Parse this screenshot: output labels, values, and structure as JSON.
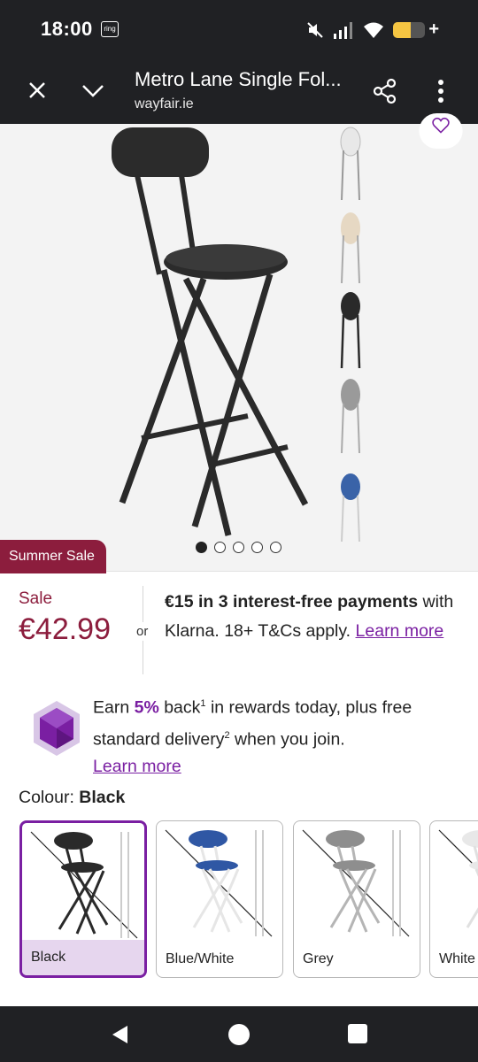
{
  "status_bar": {
    "time": "18:00",
    "ring_label": "ring",
    "battery_level": 0.55
  },
  "header": {
    "title": "Metro Lane Single Fol...",
    "url": "wayfair.ie"
  },
  "gallery": {
    "sale_tag": "Summer Sale",
    "pages": 5,
    "active_page": 1,
    "thumbnail_colors": [
      "#e8e8e8",
      "#e6d8c3",
      "#2a2a2a",
      "#9a9a9a",
      "#3a63a8"
    ]
  },
  "price": {
    "sale_label": "Sale",
    "value": "€42.99",
    "or_text": "or"
  },
  "klarna": {
    "headline": "€15 in 3 interest-free payments",
    "rest": " with Klarna. 18+ T&Cs apply. ",
    "learn_more": "Learn more"
  },
  "rewards": {
    "earn": "Earn ",
    "percent": "5%",
    "back": " back",
    "sup1": "1",
    "mid": " in rewards today, plus free standard delivery",
    "sup2": "2",
    "end": " when you join.",
    "learn_more": "Learn more"
  },
  "colour": {
    "label": "Colour: ",
    "selected": "Black",
    "options": [
      {
        "label": "Black",
        "seat": "#2a2a2a",
        "frame": "#2a2a2a"
      },
      {
        "label": "Blue/White",
        "seat": "#2f57a4",
        "frame": "#e6e6e6"
      },
      {
        "label": "Grey",
        "seat": "#8e8e8e",
        "frame": "#b5b5b5"
      },
      {
        "label": "White",
        "seat": "#e8e8e8",
        "frame": "#e0e0e0"
      }
    ]
  },
  "colors": {
    "accent": "#7a1fa2",
    "sale": "#8c1d3d",
    "bar": "#202124"
  }
}
